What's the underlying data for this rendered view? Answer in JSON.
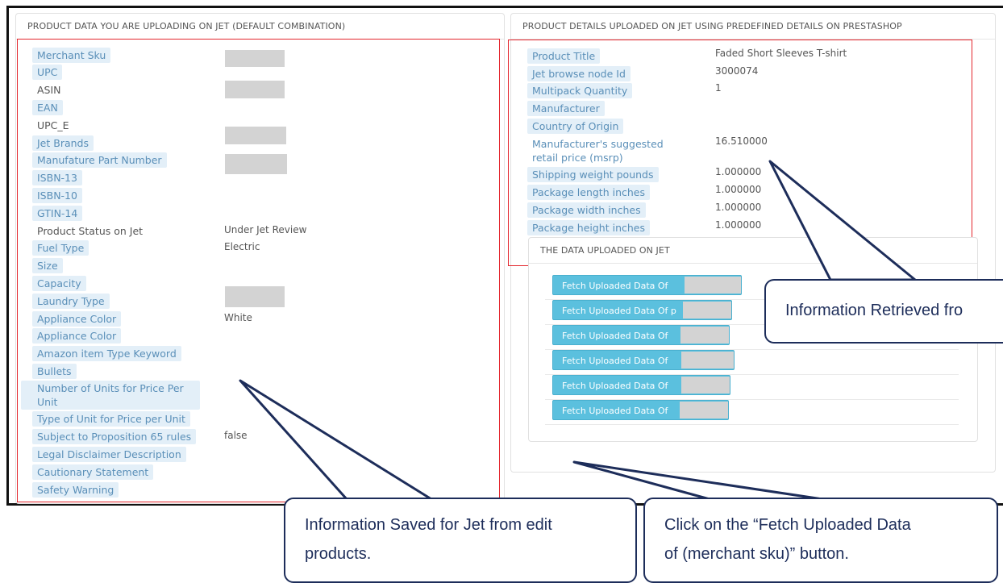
{
  "left_panel": {
    "title": "PRODUCT DATA YOU ARE UPLOADING ON JET (DEFAULT COMBINATION)",
    "rows": [
      {
        "label": "Merchant Sku",
        "value": "",
        "masked": true
      },
      {
        "label": "UPC",
        "value": "",
        "masked": false
      },
      {
        "label": "ASIN",
        "value": "",
        "masked": true,
        "plain": true
      },
      {
        "label": "EAN",
        "value": "",
        "masked": false
      },
      {
        "label": "UPC_E",
        "value": "",
        "masked": false,
        "plain": true
      },
      {
        "label": "Jet Brands",
        "value": "",
        "masked": true
      },
      {
        "label": "Manufature Part Number",
        "value": "",
        "masked": true
      },
      {
        "label": "ISBN-13",
        "value": ""
      },
      {
        "label": "ISBN-10",
        "value": ""
      },
      {
        "label": "GTIN-14",
        "value": ""
      },
      {
        "label": "Product Status on Jet",
        "value": "Under Jet Review",
        "plain": true
      },
      {
        "label": "Fuel Type",
        "value": "Electric"
      },
      {
        "label": "Size",
        "value": ""
      },
      {
        "label": "Capacity",
        "value": ""
      },
      {
        "label": "Laundry Type",
        "value": "",
        "masked": true
      },
      {
        "label": "Appliance Color",
        "value": "White"
      },
      {
        "label": "Appliance Color",
        "value": ""
      },
      {
        "label": "Amazon item Type Keyword",
        "value": ""
      },
      {
        "label": "Bullets",
        "value": ""
      },
      {
        "label": "Number of Units for Price Per Unit",
        "value": ""
      },
      {
        "label": "Type of Unit for Price per Unit",
        "value": ""
      },
      {
        "label": "Subject to Proposition 65 rules",
        "value": "false"
      },
      {
        "label": "Legal Disclaimer Description",
        "value": ""
      },
      {
        "label": "Cautionary Statement",
        "value": ""
      },
      {
        "label": "Safety Warning",
        "value": ""
      }
    ]
  },
  "right_panel": {
    "title": "PRODUCT DETAILS UPLOADED ON JET USING PREDEFINED DETAILS ON PRESTASHOP",
    "rows": [
      {
        "label": "Product Title",
        "value": "Faded Short Sleeves T-shirt"
      },
      {
        "label": "Jet browse node Id",
        "value": "3000074"
      },
      {
        "label": "Multipack Quantity",
        "value": "1"
      },
      {
        "label": "Manufacturer",
        "value": ""
      },
      {
        "label": "Country of Origin",
        "value": ""
      },
      {
        "label": "Manufacturer's suggested retail price (msrp)",
        "value": "16.510000"
      },
      {
        "label": "Shipping weight pounds",
        "value": "1.000000"
      },
      {
        "label": "Package length inches",
        "value": "1.000000"
      },
      {
        "label": "Package width inches",
        "value": "1.000000"
      },
      {
        "label": "Package height inches",
        "value": "1.000000"
      }
    ],
    "sub_panel": {
      "title": "THE DATA UPLOADED ON JET",
      "buttons": [
        "Fetch Uploaded Data Of",
        "Fetch Uploaded Data Of p",
        "Fetch Uploaded Data Of",
        "Fetch Uploaded Data Of",
        "Fetch Uploaded Data Of",
        "Fetch Uploaded Data Of"
      ]
    }
  },
  "callouts": {
    "retrieved": "Information Retrieved fro",
    "saved_line1": "Information Saved for Jet from edit",
    "saved_line2": "products.",
    "click_line1": "Click on the “Fetch Uploaded Data",
    "click_line2": "of (merchant  sku)” button."
  },
  "colors": {
    "highlight_border": "#e3262d",
    "label_bg": "#e3eff8",
    "label_text": "#5a8fb8",
    "button_bg": "#5bc0de",
    "callout_border": "#1d2d5a"
  }
}
